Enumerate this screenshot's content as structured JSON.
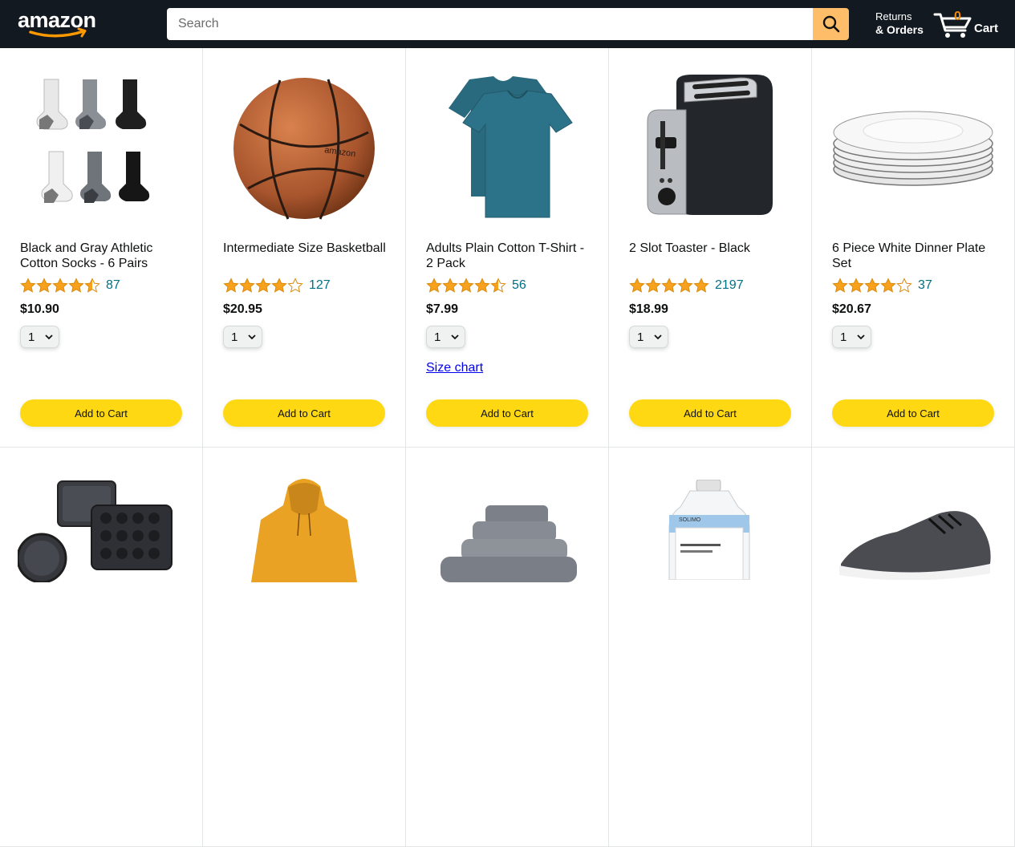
{
  "header": {
    "logo_text": "amazon",
    "search_placeholder": "Search",
    "returns_line1": "Returns",
    "returns_line2": "& Orders",
    "cart_count": "0",
    "cart_label": "Cart"
  },
  "products": [
    {
      "name": "Black and Gray Athletic Cotton Socks - 6 Pairs",
      "rating": 4.5,
      "rating_count": "87",
      "price": "$10.90",
      "qty": "1",
      "button": "Add to Cart"
    },
    {
      "name": "Intermediate Size Basketball",
      "rating": 4.0,
      "rating_count": "127",
      "price": "$20.95",
      "qty": "1",
      "button": "Add to Cart"
    },
    {
      "name": "Adults Plain Cotton T-Shirt - 2 Pack",
      "rating": 4.5,
      "rating_count": "56",
      "price": "$7.99",
      "qty": "1",
      "button": "Add to Cart",
      "extra_link": "Size chart"
    },
    {
      "name": "2 Slot Toaster - Black",
      "rating": 5.0,
      "rating_count": "2197",
      "price": "$18.99",
      "qty": "1",
      "button": "Add to Cart"
    },
    {
      "name": "6 Piece White Dinner Plate Set",
      "rating": 4.0,
      "rating_count": "37",
      "price": "$20.67",
      "qty": "1",
      "button": "Add to Cart"
    }
  ],
  "second_row": [
    {
      "image_icon": "bakeware-set-icon"
    },
    {
      "image_icon": "hoodie-icon"
    },
    {
      "image_icon": "towels-icon"
    },
    {
      "image_icon": "detergent-bottle-icon"
    },
    {
      "image_icon": "sneaker-icon"
    }
  ],
  "colors": {
    "header_bg": "#131921",
    "search_button": "#febd69",
    "add_button": "#ffd814",
    "star": "#f8a11c",
    "link": "#007185",
    "cart_count": "#f08804"
  }
}
